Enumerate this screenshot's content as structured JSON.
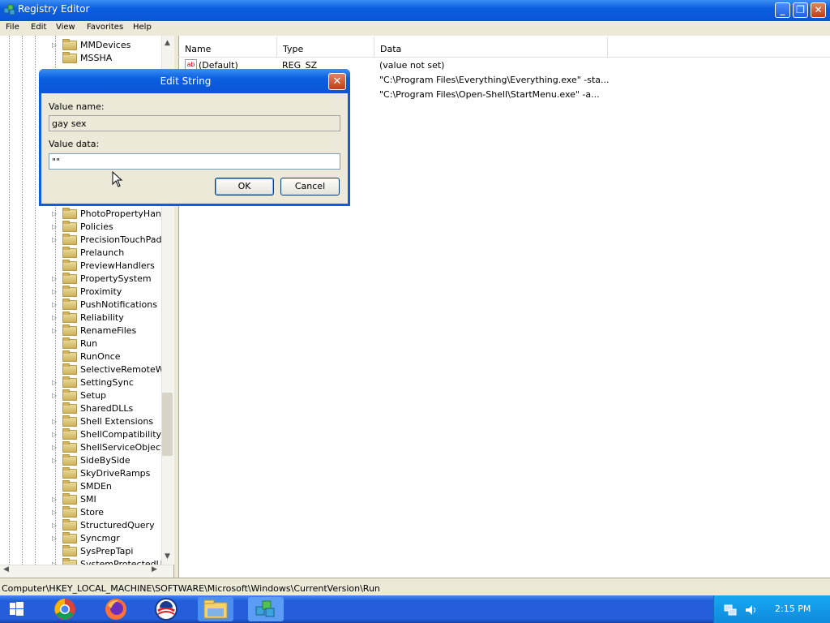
{
  "window": {
    "title": "Registry Editor",
    "min_label": "_",
    "max_label": "❐",
    "close_label": "✕"
  },
  "menu": [
    "File",
    "Edit",
    "View",
    "Favorites",
    "Help"
  ],
  "tree": {
    "items": [
      {
        "label": "MMDevices",
        "expandable": true
      },
      {
        "label": "MSSHA",
        "expandable": false
      },
      {
        "label": "PhotoPropertyHand",
        "expandable": true
      },
      {
        "label": "Policies",
        "expandable": true
      },
      {
        "label": "PrecisionTouchPad",
        "expandable": true
      },
      {
        "label": "Prelaunch",
        "expandable": false
      },
      {
        "label": "PreviewHandlers",
        "expandable": false
      },
      {
        "label": "PropertySystem",
        "expandable": true
      },
      {
        "label": "Proximity",
        "expandable": true
      },
      {
        "label": "PushNotifications",
        "expandable": true
      },
      {
        "label": "Reliability",
        "expandable": true
      },
      {
        "label": "RenameFiles",
        "expandable": true
      },
      {
        "label": "Run",
        "expandable": false
      },
      {
        "label": "RunOnce",
        "expandable": false
      },
      {
        "label": "SelectiveRemoteW",
        "expandable": false
      },
      {
        "label": "SettingSync",
        "expandable": true
      },
      {
        "label": "Setup",
        "expandable": true
      },
      {
        "label": "SharedDLLs",
        "expandable": false
      },
      {
        "label": "Shell Extensions",
        "expandable": true
      },
      {
        "label": "ShellCompatibility",
        "expandable": true
      },
      {
        "label": "ShellServiceObject",
        "expandable": true
      },
      {
        "label": "SideBySide",
        "expandable": true
      },
      {
        "label": "SkyDriveRamps",
        "expandable": false
      },
      {
        "label": "SMDEn",
        "expandable": false
      },
      {
        "label": "SMI",
        "expandable": true
      },
      {
        "label": "Store",
        "expandable": true
      },
      {
        "label": "StructuredQuery",
        "expandable": true
      },
      {
        "label": "Syncmgr",
        "expandable": true
      },
      {
        "label": "SysPrepTapi",
        "expandable": false
      },
      {
        "label": "SystemProtectedU",
        "expandable": true
      }
    ]
  },
  "list": {
    "columns": [
      "Name",
      "Type",
      "Data"
    ],
    "rows": [
      {
        "name": "(Default)",
        "type": "REG_SZ",
        "data": "(value not set)",
        "icon": "ab"
      },
      {
        "name": "",
        "type": "",
        "data": "\"C:\\Program Files\\Everything\\Everything.exe\" -sta..."
      },
      {
        "name": "",
        "type": "",
        "data": "\"C:\\Program Files\\Open-Shell\\StartMenu.exe\" -a..."
      }
    ]
  },
  "status": "Computer\\HKEY_LOCAL_MACHINE\\SOFTWARE\\Microsoft\\Windows\\CurrentVersion\\Run",
  "dialog": {
    "title": "Edit String",
    "value_name_label": "Value name:",
    "value_name": "gay sex",
    "value_data_label": "Value data:",
    "value_data": "\"\"",
    "ok_label": "OK",
    "cancel_label": "Cancel",
    "close_label": "✕"
  },
  "taskbar": {
    "apps": [
      "windows-start-icon",
      "chrome-icon",
      "firefox-icon",
      "obama-logo-icon",
      "file-explorer-icon",
      "registry-editor-icon"
    ],
    "clock": "2:15 PM",
    "tray_icons": [
      "network-icon",
      "volume-icon"
    ]
  }
}
